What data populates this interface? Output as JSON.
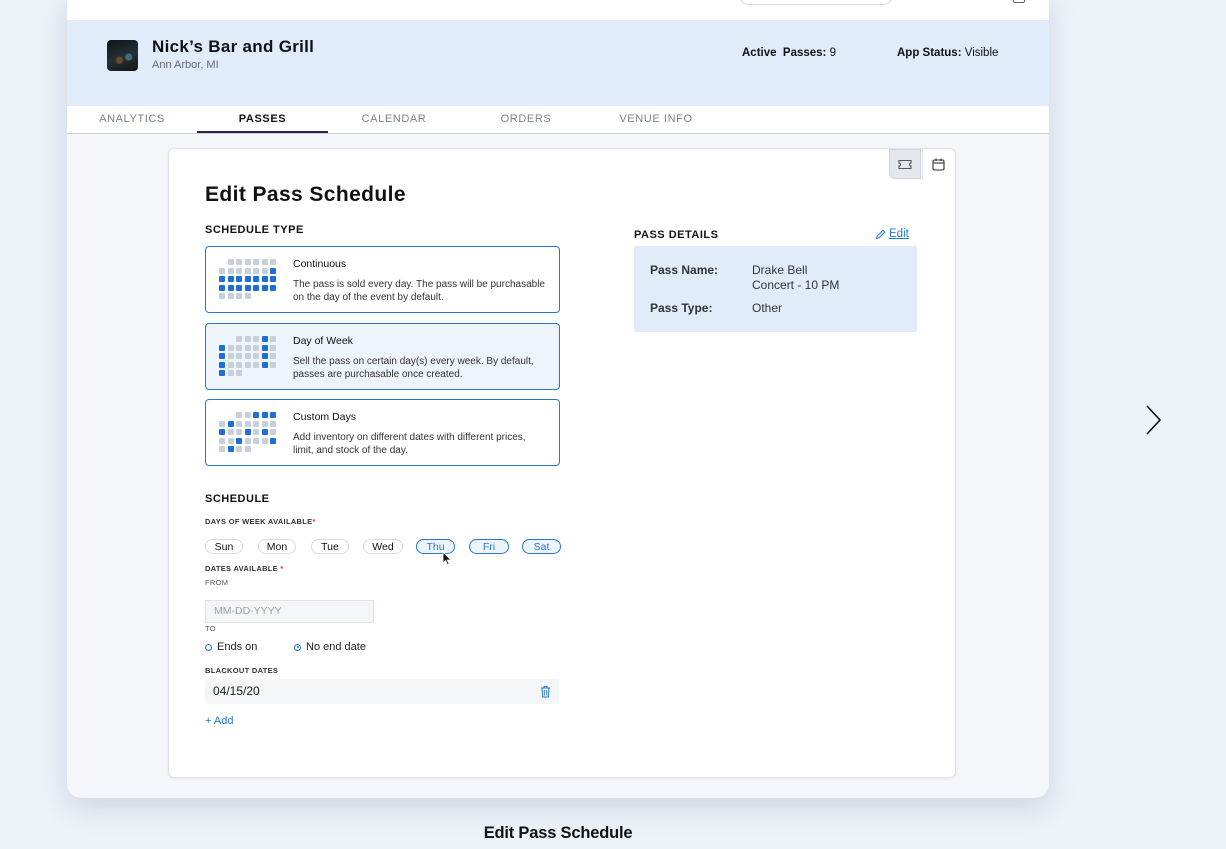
{
  "venue": {
    "name": "Nick’s Bar and Grill",
    "location": "Ann Arbor, MI",
    "active_passes_label": "Active  Passes:",
    "active_passes_value": "9",
    "app_status_label": "App Status:",
    "app_status_value": "Visible"
  },
  "tabs": [
    {
      "label": "ANALYTICS",
      "active": false
    },
    {
      "label": "PASSES",
      "active": true
    },
    {
      "label": "CALENDAR",
      "active": false
    },
    {
      "label": "ORDERS",
      "active": false
    },
    {
      "label": "VENUE INFO",
      "active": false
    }
  ],
  "view_toggle": {
    "selected": "ticket-icon",
    "other": "calendar-icon"
  },
  "edit": {
    "title": "Edit Pass Schedule",
    "schedule_type_label": "SCHEDULE TYPE",
    "options": [
      {
        "title": "Continuous",
        "desc": "The pass is sold every day. The pass will be purchasable on the day of the event by default.",
        "selected": false
      },
      {
        "title": "Day of Week",
        "desc": "Sell the pass on certain day(s) every week. By default, passes are purchasable once created.",
        "selected": true
      },
      {
        "title": "Custom Days",
        "desc": "Add inventory on different dates with different prices, limit, and stock of the day.",
        "selected": false
      }
    ],
    "schedule_label": "SCHEDULE",
    "days_label": "DAYS OF WEEK AVAILABLE",
    "required_mark": "*",
    "days": [
      {
        "label": "Sun",
        "selected": false
      },
      {
        "label": "Mon",
        "selected": false
      },
      {
        "label": "Tue",
        "selected": false
      },
      {
        "label": "Wed",
        "selected": false
      },
      {
        "label": "Thu",
        "selected": true
      },
      {
        "label": "Fri",
        "selected": true
      },
      {
        "label": "Sat",
        "selected": true
      }
    ],
    "dates_label": "DATES AVAILABLE",
    "from_label": "FROM",
    "from_placeholder": "MM-DD-YYYY",
    "to_label": "TO",
    "end_options": [
      {
        "label": "Ends on",
        "selected": false
      },
      {
        "label": "No end date",
        "selected": true
      }
    ],
    "blackout_label": "BLACKOUT DATES",
    "blackout_dates": [
      "04/15/20"
    ],
    "add_label": "Add"
  },
  "pass_details": {
    "heading": "PASS DETAILS",
    "edit_label": "Edit",
    "name_key": "Pass Name:",
    "name_line1": "Drake Bell",
    "name_line2": "Concert - 10 PM",
    "type_key": "Pass Type:",
    "type_value": "Other"
  },
  "caption": "Edit Pass Schedule",
  "colors": {
    "accent": "#2478d2",
    "header_bg": "#e1ecfb",
    "page_bg": "#eef2f9"
  }
}
